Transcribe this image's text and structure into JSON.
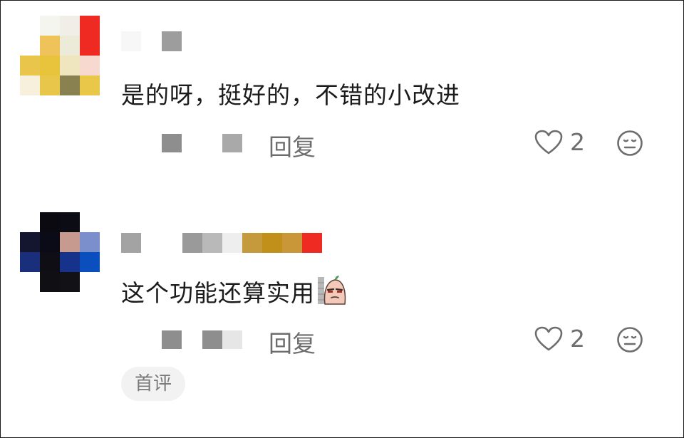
{
  "comments": [
    {
      "text": "是的呀，挺好的，不错的小改进",
      "reply_label": "回复",
      "like_count": "2"
    },
    {
      "text": "这个功能还算实用",
      "reply_label": "回复",
      "like_count": "2"
    }
  ],
  "footer": {
    "first_comment_chip": "首评"
  },
  "icons": {
    "like": "heart-outline-icon",
    "emoji": "neutral-face-icon",
    "sticker": "peach-sticker-icon"
  },
  "colors": {
    "text": "#1b1b1b",
    "meta": "#6d6d6d",
    "chip_bg": "#f2f2f2",
    "redaction_gray": "#9a9a9a"
  }
}
